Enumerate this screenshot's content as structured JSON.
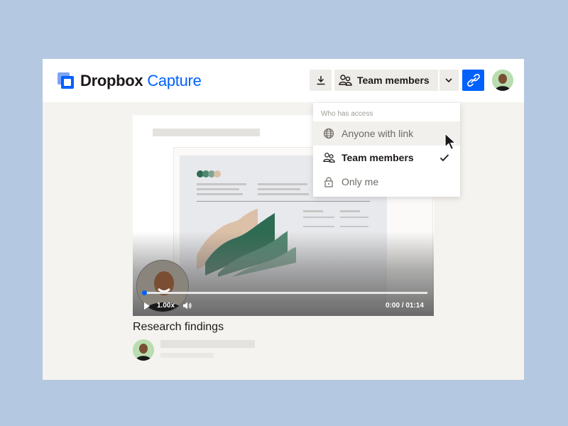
{
  "app": {
    "logo_text": "Dropbox",
    "logo_sub": "Capture"
  },
  "toolbar": {
    "share_label": "Team members"
  },
  "dropdown": {
    "heading": "Who has access",
    "items": [
      {
        "label": "Anyone with link",
        "icon": "globe-icon",
        "state": "hover"
      },
      {
        "label": "Team members",
        "icon": "people-icon",
        "selected": true
      },
      {
        "label": "Only me",
        "icon": "lock-icon"
      }
    ]
  },
  "video": {
    "speed": "1.00x",
    "time": "0:00 / 01:14",
    "progress": 0.0
  },
  "content": {
    "title": "Research findings"
  },
  "colors": {
    "brand": "#0061fe",
    "background": "#b4c8e1",
    "chart_tan": "#dcc0a8",
    "chart_dark_green": "#2d6b52",
    "chart_green": "#4f8770",
    "chart_sage": "#7ea594"
  }
}
